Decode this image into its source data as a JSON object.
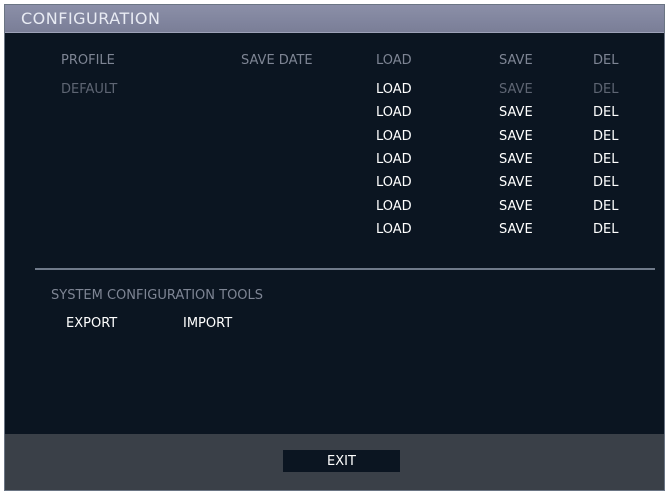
{
  "window": {
    "title": "CONFIGURATION"
  },
  "table": {
    "headers": {
      "profile": "PROFILE",
      "save_date": "SAVE DATE",
      "load": "LOAD",
      "save": "SAVE",
      "del": "DEL"
    },
    "rows": [
      {
        "profile": "DEFAULT",
        "save_date": "",
        "load": "LOAD",
        "save": "SAVE",
        "del": "DEL",
        "save_enabled": false,
        "del_enabled": false
      },
      {
        "profile": "",
        "save_date": "",
        "load": "LOAD",
        "save": "SAVE",
        "del": "DEL",
        "save_enabled": true,
        "del_enabled": true
      },
      {
        "profile": "",
        "save_date": "",
        "load": "LOAD",
        "save": "SAVE",
        "del": "DEL",
        "save_enabled": true,
        "del_enabled": true
      },
      {
        "profile": "",
        "save_date": "",
        "load": "LOAD",
        "save": "SAVE",
        "del": "DEL",
        "save_enabled": true,
        "del_enabled": true
      },
      {
        "profile": "",
        "save_date": "",
        "load": "LOAD",
        "save": "SAVE",
        "del": "DEL",
        "save_enabled": true,
        "del_enabled": true
      },
      {
        "profile": "",
        "save_date": "",
        "load": "LOAD",
        "save": "SAVE",
        "del": "DEL",
        "save_enabled": true,
        "del_enabled": true
      },
      {
        "profile": "",
        "save_date": "",
        "load": "LOAD",
        "save": "SAVE",
        "del": "DEL",
        "save_enabled": true,
        "del_enabled": true
      }
    ]
  },
  "tools": {
    "label": "SYSTEM CONFIGURATION TOOLS",
    "export_label": "EXPORT",
    "import_label": "IMPORT"
  },
  "footer": {
    "exit_label": "EXIT"
  },
  "colors": {
    "background": "#0b1521",
    "titlebar": "#8b8fa8",
    "footer": "#3a4048",
    "enabled_text": "#ffffff",
    "disabled_text": "#5e6573"
  }
}
